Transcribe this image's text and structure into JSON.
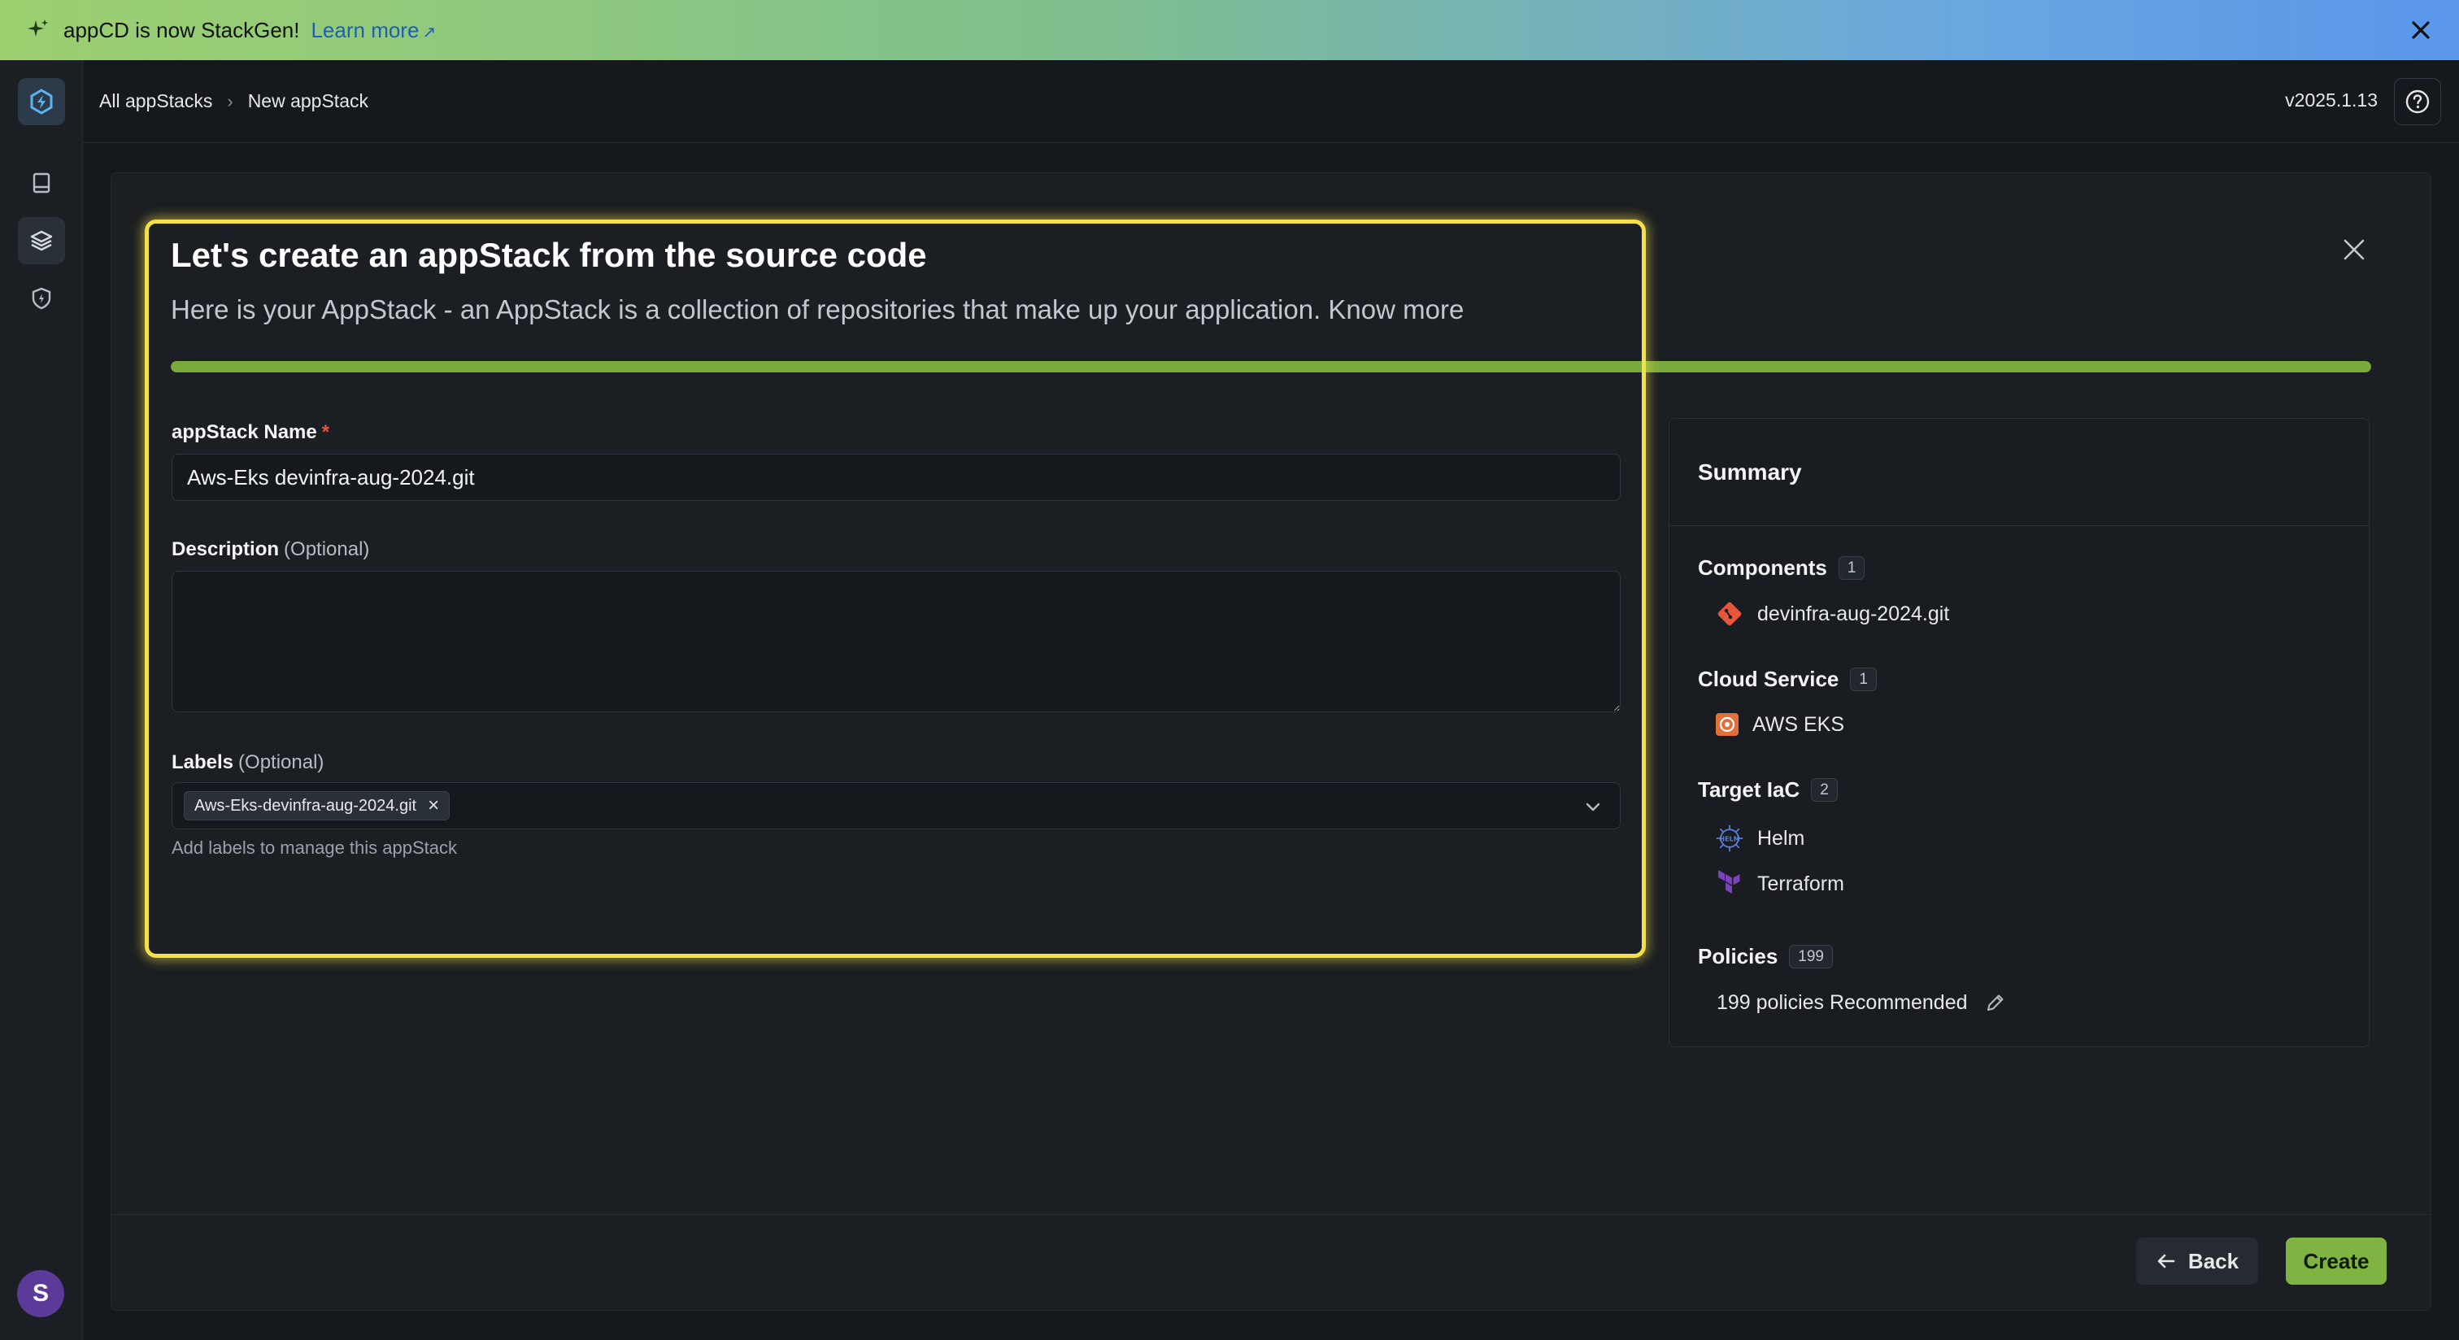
{
  "banner": {
    "message": "appCD is now StackGen!",
    "link_label": "Learn more",
    "link_arrow": "↗"
  },
  "sidebar": {
    "items": [
      {
        "name": "catalog",
        "icon": "book-icon"
      },
      {
        "name": "appstacks",
        "icon": "layers-icon",
        "active": true
      },
      {
        "name": "policies",
        "icon": "shield-icon"
      }
    ],
    "avatar_initial": "S"
  },
  "header": {
    "breadcrumb": [
      "All appStacks",
      "New appStack"
    ],
    "version": "v2025.1.13"
  },
  "form": {
    "title": "Let's create an appStack from the source code",
    "subtitle": "Here is your AppStack - an AppStack is a collection of repositories that make up your application.",
    "know_more": "Know more",
    "progress": 1.0,
    "name_label": "appStack Name",
    "required_mark": "*",
    "name_value": "Aws-Eks devinfra-aug-2024.git",
    "description_label": "Description",
    "description_optional": "(Optional)",
    "description_value": "",
    "labels_label": "Labels",
    "labels_optional": "(Optional)",
    "labels_chips": [
      "Aws-Eks-devinfra-aug-2024.git"
    ],
    "labels_hint": "Add labels to manage this appStack"
  },
  "summary": {
    "title": "Summary",
    "components": {
      "label": "Components",
      "count": "1",
      "items": [
        "devinfra-aug-2024.git"
      ]
    },
    "cloud_service": {
      "label": "Cloud Service",
      "count": "1",
      "items": [
        "AWS EKS"
      ]
    },
    "target_iac": {
      "label": "Target IaC",
      "count": "2",
      "items": [
        "Helm",
        "Terraform"
      ]
    },
    "policies": {
      "label": "Policies",
      "count": "199",
      "text": "199 policies Recommended"
    }
  },
  "footer": {
    "back_label": "Back",
    "create_label": "Create"
  },
  "colors": {
    "accent_green": "#7fb443",
    "highlight_yellow": "#f3e04a",
    "required_red": "#e5534b"
  }
}
